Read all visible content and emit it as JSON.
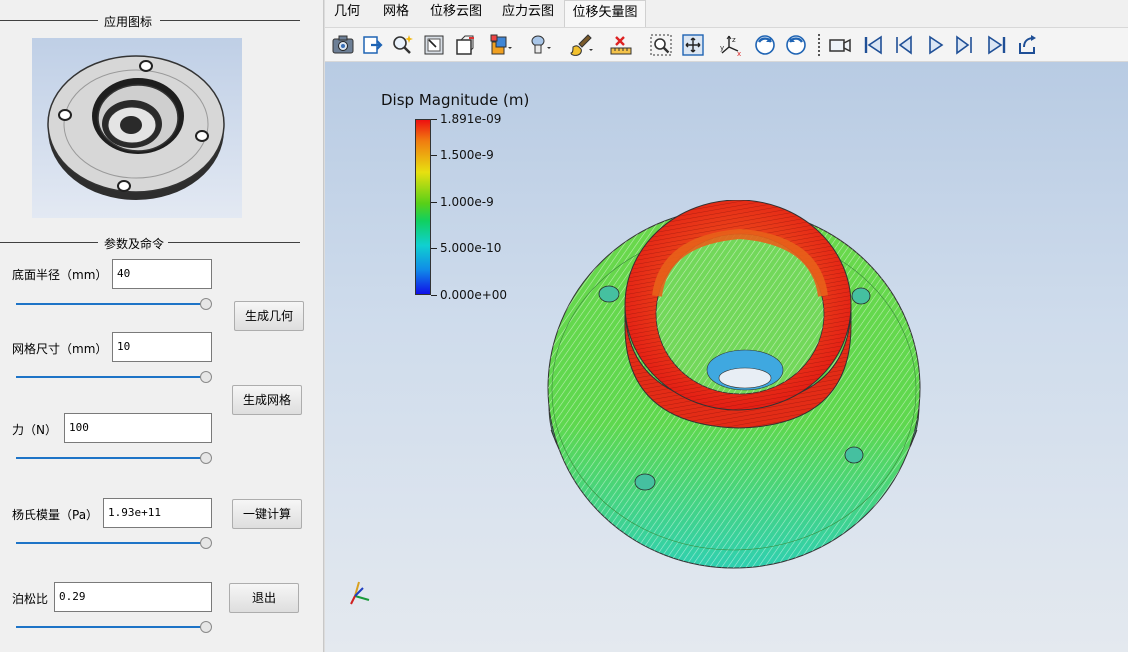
{
  "left_panel": {
    "icon_group_title": "应用图标",
    "params_group_title": "参数及命令",
    "params": [
      {
        "label": "底面半径（mm）",
        "value": "40"
      },
      {
        "label": "网格尺寸（mm）",
        "value": "10"
      },
      {
        "label": "力（N）",
        "value": "100"
      },
      {
        "label": "杨氏模量（Pa）",
        "value": "1.93e+11"
      },
      {
        "label": "泊松比",
        "value": "0.29"
      }
    ],
    "slider_levels": [
      1.0,
      1.0,
      1.0,
      1.0,
      1.0
    ],
    "buttons": {
      "generate_geometry": "生成几何",
      "generate_mesh": "生成网格",
      "compute": "一键计算",
      "exit": "退出"
    }
  },
  "tabs": [
    {
      "label": "几何"
    },
    {
      "label": "网格"
    },
    {
      "label": "位移云图"
    },
    {
      "label": "应力云图"
    },
    {
      "label": "位移矢量图",
      "active": true
    }
  ],
  "toolbar": {
    "icons": [
      "camera-icon",
      "export-icon",
      "zoom-wand-icon",
      "select-box-icon",
      "surface-icon",
      "color-map-icon",
      "light-icon",
      "brush-icon",
      "ruler-icon",
      "zoom-region-icon",
      "fit-view-icon",
      "axes-icon",
      "rotate-cw-icon",
      "rotate-ccw-icon",
      "video-camera-icon",
      "first-frame-icon",
      "previous-frame-icon",
      "play-icon",
      "next-frame-icon",
      "last-frame-icon",
      "loop-icon"
    ]
  },
  "viewport": {
    "legend_title": "Disp Magnitude (m)",
    "legend_ticks": [
      {
        "label": "1.891e-09",
        "value": 1.891e-09
      },
      {
        "label": "1.500e-9",
        "value": 1.5e-09
      },
      {
        "label": "1.000e-9",
        "value": 1e-09
      },
      {
        "label": "5.000e-10",
        "value": 5e-10
      },
      {
        "label": "0.000e+00",
        "value": 0.0
      }
    ],
    "legend_range": [
      0.0,
      1.891e-09
    ],
    "colormap": [
      "#1010e8",
      "#10d0d0",
      "#58d018",
      "#e8e010",
      "#ee1010"
    ],
    "background_top": "#b8cbe3",
    "background_bottom": "#e4e9ef"
  }
}
